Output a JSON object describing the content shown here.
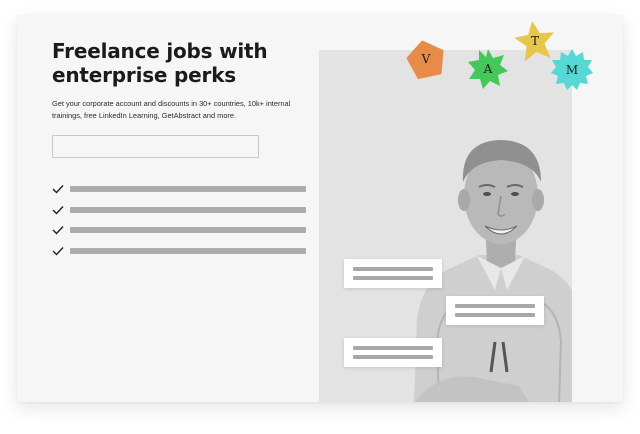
{
  "hero": {
    "headline": "Freelance jobs with enterprise perks",
    "subtext": "Get your corporate account and discounts in 30+ countries, 10k+ internal trainings, free LinkedIn Learning, GetAbstract and more.",
    "input_value": ""
  },
  "checklist": [
    {
      "icon": "check-icon"
    },
    {
      "icon": "check-icon"
    },
    {
      "icon": "check-icon"
    },
    {
      "icon": "check-icon"
    }
  ],
  "badges": [
    {
      "letter": "V",
      "color": "#e98b48"
    },
    {
      "letter": "A",
      "color": "#43c85a"
    },
    {
      "letter": "T",
      "color": "#e7c64a"
    },
    {
      "letter": "M",
      "color": "#56d8d4"
    }
  ],
  "colors": {
    "card_bg": "#f6f6f6",
    "panel_bg": "#e3e3e3",
    "placeholder_bar": "#acacac",
    "text": "#1b1b1b"
  }
}
